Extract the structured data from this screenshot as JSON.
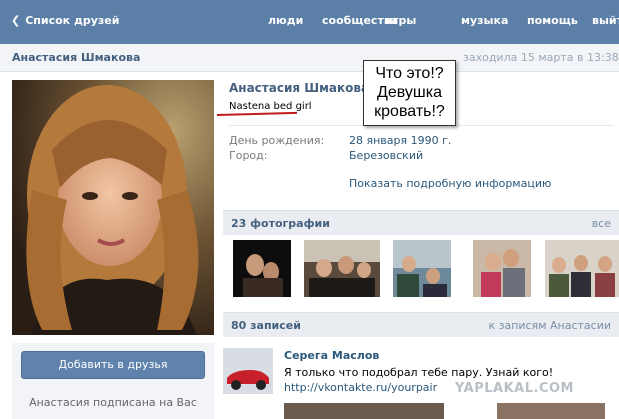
{
  "topbar": {
    "back_label": "Список друзей",
    "nav": [
      "люди",
      "сообщества",
      "игры",
      "музыка",
      "помощь",
      "выйти"
    ]
  },
  "header": {
    "name": "Анастасия Шмакова",
    "last_seen": "заходила 15 марта в 13:38"
  },
  "profile": {
    "name": "Анастасия Шмакова",
    "status": "Nastena bed girl",
    "fields": [
      {
        "label": "День рождения:",
        "value": "28 января 1990 г."
      },
      {
        "label": "Город:",
        "value": "Березовский"
      }
    ],
    "more_info": "Показать подробную информацию"
  },
  "bubble": {
    "lines": [
      "Что это!?",
      "Девушка",
      "кровать!?"
    ]
  },
  "left": {
    "add_friend": "Добавить в друзья",
    "subscribed": "Анастасия подписана на Вас"
  },
  "photos": {
    "title": "23 фотографии",
    "all_link": "все"
  },
  "wall": {
    "title": "80 записей",
    "to_wall": "к записям Анастасии",
    "post": {
      "author": "Серега Маслов",
      "text": "Я только что подобрал тебе пару. Узнай кого!",
      "link": "http://vkontakte.ru/yourpair"
    }
  },
  "watermark": "YAPLAKAL.COM",
  "colors": {
    "topbar": "#5b7fa6",
    "accent": "#2b587a",
    "red": "#c01b1b"
  }
}
